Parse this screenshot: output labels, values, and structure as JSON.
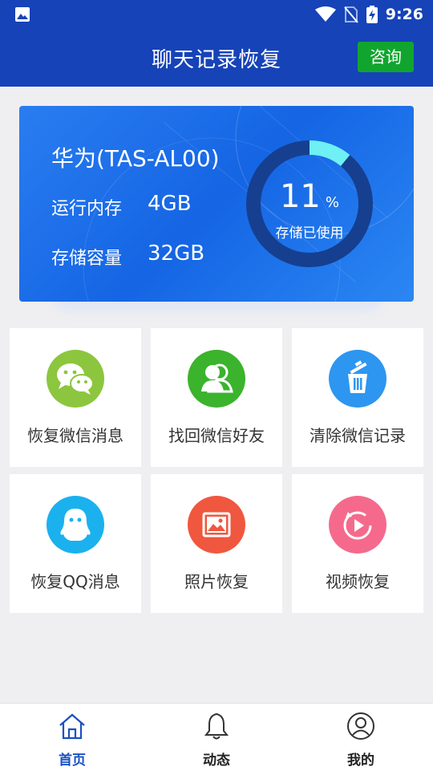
{
  "status_bar": {
    "time": "9:26"
  },
  "header": {
    "title": "聊天记录恢复",
    "consult_label": "咨询"
  },
  "device_card": {
    "model": "华为(TAS-AL00)",
    "ram_label": "运行内存",
    "ram_value": "4GB",
    "storage_label": "存储容量",
    "storage_value": "32GB",
    "used_percent": "11",
    "used_fraction": 0.11,
    "percent_unit": "%",
    "used_label": "存储已使用"
  },
  "tools": [
    {
      "label": "恢复微信消息",
      "icon": "wechat-icon",
      "color": "#8cc63e"
    },
    {
      "label": "找回微信好友",
      "icon": "contacts-icon",
      "color": "#3bb32d"
    },
    {
      "label": "清除微信记录",
      "icon": "trash-icon",
      "color": "#2d96f0"
    },
    {
      "label": "恢复QQ消息",
      "icon": "qq-penguin-icon",
      "color": "#1bb1ee"
    },
    {
      "label": "照片恢复",
      "icon": "photo-icon",
      "color": "#f0573f"
    },
    {
      "label": "视频恢复",
      "icon": "video-play-icon",
      "color": "#f56a8c"
    }
  ],
  "tabs": [
    {
      "label": "首页",
      "icon": "home-icon",
      "active": true
    },
    {
      "label": "动态",
      "icon": "bell-icon",
      "active": false
    },
    {
      "label": "我的",
      "icon": "user-icon",
      "active": false
    }
  ],
  "colors": {
    "brand": "#1643b8",
    "consult_button": "#11a52f",
    "gauge_track": "#163f8f",
    "gauge_fill": "#6ef0f4",
    "active_tab": "#1a50c4"
  }
}
